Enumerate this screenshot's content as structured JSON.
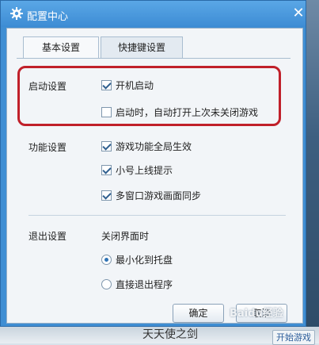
{
  "window": {
    "title": "配置中心",
    "close_glyph": "✕"
  },
  "tabs": [
    {
      "label": "基本设置",
      "active": true
    },
    {
      "label": "快捷键设置",
      "active": false
    }
  ],
  "startup": {
    "label": "启动设置",
    "options": [
      {
        "label": "开机启动",
        "checked": true
      },
      {
        "label": "启动时，自动打开上次未关闭游戏",
        "checked": false
      }
    ]
  },
  "features": {
    "label": "功能设置",
    "options": [
      {
        "label": "游戏功能全局生效",
        "checked": true
      },
      {
        "label": "小号上线提示",
        "checked": true
      },
      {
        "label": "多窗口游戏画面同步",
        "checked": true
      }
    ]
  },
  "exit": {
    "label": "退出设置",
    "sublabel": "关闭界面时",
    "options": [
      {
        "label": "最小化到托盘",
        "selected": true
      },
      {
        "label": "直接退出程序",
        "selected": false
      }
    ]
  },
  "buttons": {
    "ok": "确定",
    "cancel": "取消"
  },
  "background": {
    "bottom_text": "天天使之剑",
    "bottom_button": "开始游戏"
  },
  "watermark": "Baidu经验",
  "colors": {
    "titlebar": "#3d8cd4",
    "highlight": "#c0202a",
    "panel": "#f2f5f8"
  }
}
